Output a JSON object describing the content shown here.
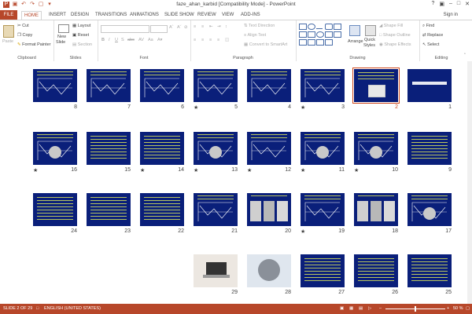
{
  "window": {
    "title": "faze_ahan_karbid [Compatibility Mode] - PowerPoint"
  },
  "tabs": [
    "FILE",
    "HOME",
    "INSERT",
    "DESIGN",
    "TRANSITIONS",
    "ANIMATIONS",
    "SLIDE SHOW",
    "REVIEW",
    "VIEW",
    "ADD-INS"
  ],
  "signin": "Sign in",
  "ribbon": {
    "clipboard": {
      "label": "Clipboard",
      "paste": "Paste",
      "cut": "Cut",
      "copy": "Copy",
      "format_painter": "Format Painter"
    },
    "slides": {
      "label": "Slides",
      "new_slide": "New",
      "new_slide2": "Slide",
      "layout": "Layout",
      "reset": "Reset",
      "section": "Section"
    },
    "font": {
      "label": "Font"
    },
    "paragraph": {
      "label": "Paragraph",
      "text_direction": "Text Direction",
      "align_text": "Align Text",
      "convert": "Convert to SmartArt"
    },
    "drawing": {
      "label": "Drawing",
      "arrange": "Arrange",
      "quick": "Quick",
      "styles": "Styles",
      "shape_fill": "Shape Fill",
      "shape_outline": "Shape Outline",
      "shape_effects": "Shape Effects"
    },
    "editing": {
      "label": "Editing",
      "find": "Find",
      "replace": "Replace",
      "select": "Select"
    }
  },
  "slides": [
    {
      "n": "1",
      "star": false,
      "kind": "title"
    },
    {
      "n": "2",
      "star": false,
      "kind": "image-center",
      "selected": true
    },
    {
      "n": "3",
      "star": true,
      "kind": "graph"
    },
    {
      "n": "4",
      "star": false,
      "kind": "graph"
    },
    {
      "n": "5",
      "star": true,
      "kind": "graph"
    },
    {
      "n": "6",
      "star": false,
      "kind": "graph"
    },
    {
      "n": "7",
      "star": false,
      "kind": "graph"
    },
    {
      "n": "8",
      "star": false,
      "kind": "graph"
    },
    {
      "n": "9",
      "star": false,
      "kind": "text"
    },
    {
      "n": "10",
      "star": true,
      "kind": "graph-img"
    },
    {
      "n": "11",
      "star": true,
      "kind": "graph-img"
    },
    {
      "n": "12",
      "star": true,
      "kind": "graph"
    },
    {
      "n": "13",
      "star": true,
      "kind": "graph-img"
    },
    {
      "n": "14",
      "star": true,
      "kind": "text"
    },
    {
      "n": "15",
      "star": false,
      "kind": "text"
    },
    {
      "n": "16",
      "star": true,
      "kind": "graph-img"
    },
    {
      "n": "17",
      "star": false,
      "kind": "graph-img"
    },
    {
      "n": "18",
      "star": false,
      "kind": "images"
    },
    {
      "n": "19",
      "star": true,
      "kind": "graph"
    },
    {
      "n": "20",
      "star": false,
      "kind": "images"
    },
    {
      "n": "21",
      "star": false,
      "kind": "graph"
    },
    {
      "n": "22",
      "star": false,
      "kind": "text"
    },
    {
      "n": "23",
      "star": false,
      "kind": "text"
    },
    {
      "n": "24",
      "star": false,
      "kind": "text"
    },
    {
      "n": "25",
      "star": false,
      "kind": "text"
    },
    {
      "n": "26",
      "star": false,
      "kind": "text"
    },
    {
      "n": "27",
      "star": false,
      "kind": "text"
    },
    {
      "n": "28",
      "star": false,
      "kind": "photo-lab"
    },
    {
      "n": "29",
      "star": false,
      "kind": "photo-laptop"
    }
  ],
  "status": {
    "slide": "SLIDE 2 OF 29",
    "lang": "ENGLISH (UNITED STATES)",
    "zoom": "50 %"
  },
  "colors": {
    "accent": "#b7472a",
    "slide_bg": "#0a1f7a"
  }
}
